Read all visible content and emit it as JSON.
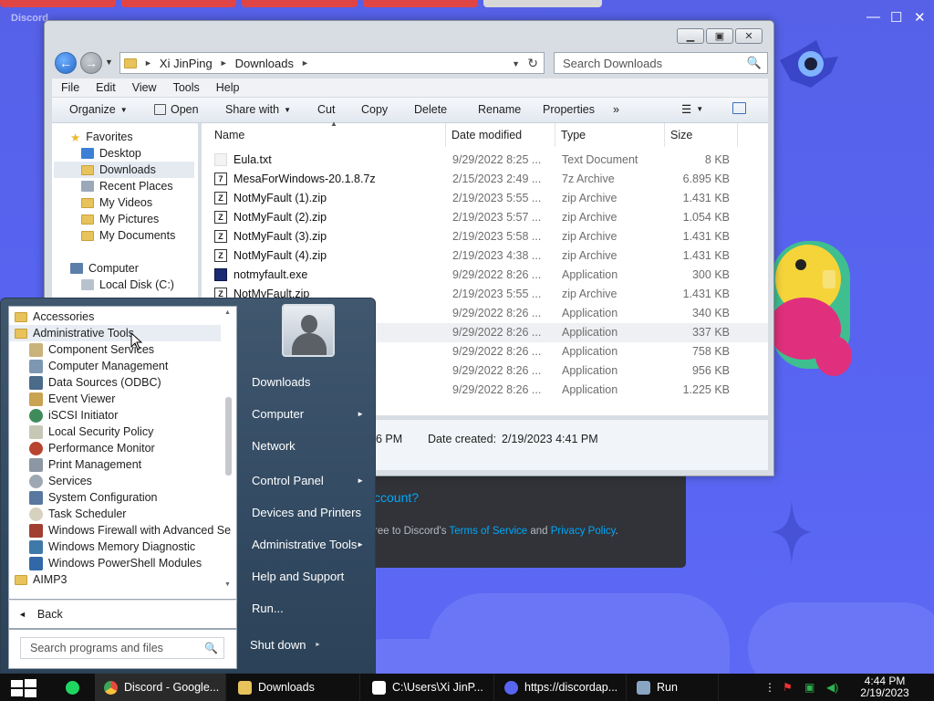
{
  "discord": {
    "title": "Discord",
    "forgot_tail": "ccount?",
    "tos_pre": "ree to Discord's ",
    "tos_link": "Terms of Service",
    "tos_mid": " and ",
    "privacy_link": "Privacy Policy",
    "tos_end": "."
  },
  "explorer": {
    "address": {
      "root": "Xi JinPing",
      "folder": "Downloads"
    },
    "search_placeholder": "Search Downloads",
    "menu": [
      "File",
      "Edit",
      "View",
      "Tools",
      "Help"
    ],
    "commands": {
      "organize": "Organize",
      "open": "Open",
      "share_with": "Share with",
      "cut": "Cut",
      "copy": "Copy",
      "delete": "Delete",
      "rename": "Rename",
      "properties": "Properties",
      "more": "»"
    },
    "nav": {
      "favorites": "Favorites",
      "desktop": "Desktop",
      "downloads": "Downloads",
      "recent_places": "Recent Places",
      "my_videos": "My Videos",
      "my_pictures": "My Pictures",
      "my_documents": "My Documents",
      "computer": "Computer",
      "local_disk": "Local Disk (C:)"
    },
    "columns": {
      "name": "Name",
      "date": "Date modified",
      "type": "Type",
      "size": "Size"
    },
    "files": [
      {
        "name": "Eula.txt",
        "date": "9/29/2022 8:25 ...",
        "type": "Text Document",
        "size": "8 KB"
      },
      {
        "name": "MesaForWindows-20.1.8.7z",
        "date": "2/15/2023 2:49 ...",
        "type": "7z Archive",
        "size": "6.895 KB"
      },
      {
        "name": "NotMyFault (1).zip",
        "date": "2/19/2023 5:55 ...",
        "type": "zip Archive",
        "size": "1.431 KB"
      },
      {
        "name": "NotMyFault (2).zip",
        "date": "2/19/2023 5:57 ...",
        "type": "zip Archive",
        "size": "1.054 KB"
      },
      {
        "name": "NotMyFault (3).zip",
        "date": "2/19/2023 5:58 ...",
        "type": "zip Archive",
        "size": "1.431 KB"
      },
      {
        "name": "NotMyFault (4).zip",
        "date": "2/19/2023 4:38 ...",
        "type": "zip Archive",
        "size": "1.431 KB"
      },
      {
        "name": "notmyfault.exe",
        "date": "9/29/2022 8:26 ...",
        "type": "Application",
        "size": "300 KB"
      },
      {
        "name": "NotMyFault.zip",
        "date": "2/19/2023 5:55 ...",
        "type": "zip Archive",
        "size": "1.431 KB"
      },
      {
        "name": "",
        "date": "9/29/2022 8:26 ...",
        "type": "Application",
        "size": "340 KB"
      },
      {
        "name": "",
        "date": "9/29/2022 8:26 ...",
        "type": "Application",
        "size": "337 KB"
      },
      {
        "name": "",
        "date": "9/29/2022 8:26 ...",
        "type": "Application",
        "size": "758 KB"
      },
      {
        "name": "",
        "date": "9/29/2022 8:26 ...",
        "type": "Application",
        "size": "956 KB"
      },
      {
        "name": "",
        "date": "9/29/2022 8:26 ...",
        "type": "Application",
        "size": "1.225 KB"
      }
    ],
    "details": {
      "modified_tail": "6 PM",
      "created_label": "Date created:",
      "created_value": "2/19/2023 4:41 PM"
    }
  },
  "startmenu": {
    "programs": [
      {
        "label": "Accessories",
        "icon": "folder-icon"
      },
      {
        "label": "Administrative Tools",
        "icon": "folder-icon"
      },
      {
        "label": "Component Services",
        "icon": "component-services-icon"
      },
      {
        "label": "Computer Management",
        "icon": "computer-management-icon"
      },
      {
        "label": "Data Sources (ODBC)",
        "icon": "odbc-icon"
      },
      {
        "label": "Event Viewer",
        "icon": "event-viewer-icon"
      },
      {
        "label": "iSCSI Initiator",
        "icon": "iscsi-icon"
      },
      {
        "label": "Local Security Policy",
        "icon": "security-policy-icon"
      },
      {
        "label": "Performance Monitor",
        "icon": "performance-monitor-icon"
      },
      {
        "label": "Print Management",
        "icon": "print-management-icon"
      },
      {
        "label": "Services",
        "icon": "services-icon"
      },
      {
        "label": "System Configuration",
        "icon": "system-configuration-icon"
      },
      {
        "label": "Task Scheduler",
        "icon": "task-scheduler-icon"
      },
      {
        "label": "Windows Firewall with Advanced Se",
        "icon": "firewall-icon"
      },
      {
        "label": "Windows Memory Diagnostic",
        "icon": "memory-diagnostic-icon"
      },
      {
        "label": "Windows PowerShell Modules",
        "icon": "powershell-icon"
      },
      {
        "label": "AIMP3",
        "icon": "folder-icon"
      }
    ],
    "back": "Back",
    "search_placeholder": "Search programs and files",
    "right_links": [
      "Downloads",
      "Computer",
      "Network",
      "Control Panel",
      "Devices and Printers",
      "Administrative Tools",
      "Help and Support",
      "Run..."
    ],
    "shutdown": "Shut down"
  },
  "taskbar": {
    "items": [
      "Discord - Google...",
      "Downloads",
      "C:\\Users\\Xi JinP...",
      "https://discordap...",
      "Run"
    ],
    "time": "4:44 PM",
    "date": "2/19/2023"
  },
  "colors": {
    "discord_blurple": "#5865f2",
    "link_blue": "#00a8fc",
    "taskbar": "#0f0f0f",
    "startmenu": "#324a62"
  }
}
